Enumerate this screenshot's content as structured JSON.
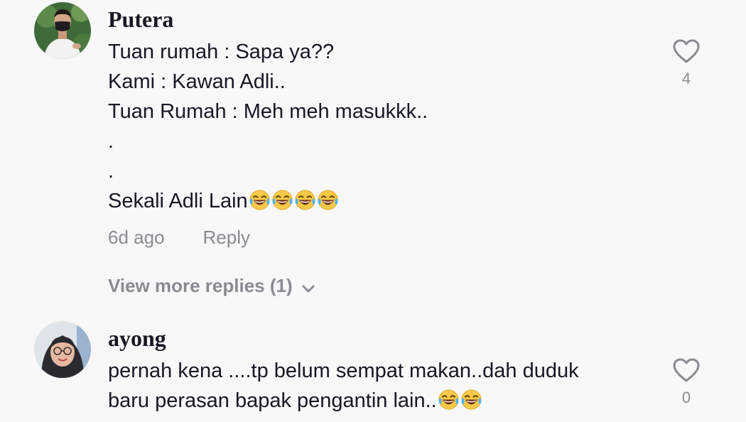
{
  "colors": {
    "background": "#f8f8f8",
    "text_primary": "#161823",
    "text_secondary": "#8a8b91",
    "heart_outline": "#8a8b91"
  },
  "comments": [
    {
      "username": "Putera",
      "avatar_icon": "user-avatar-masked-man",
      "lines": [
        "Tuan rumah : Sapa ya??",
        "Kami : Kawan Adli..",
        "Tuan Rumah : Meh meh masukkk..",
        ".",
        ".",
        "Sekali Adli Lain"
      ],
      "trailing_emoji": [
        "face-with-tears-of-joy",
        "face-with-tears-of-joy",
        "face-with-tears-of-joy",
        "face-with-tears-of-joy"
      ],
      "timestamp": "6d ago",
      "reply_label": "Reply",
      "like_icon": "heart-outline-icon",
      "like_count": "4",
      "view_more_replies": "View more replies (1)"
    },
    {
      "username": "ayong",
      "avatar_icon": "user-avatar-woman-glasses",
      "lines": [
        "pernah kena ....tp belum sempat makan..dah duduk",
        "baru perasan bapak pengantin lain.."
      ],
      "trailing_emoji": [
        "face-with-tears-of-joy",
        "face-with-tears-of-joy"
      ],
      "like_icon": "heart-outline-icon",
      "like_count": "0"
    }
  ]
}
